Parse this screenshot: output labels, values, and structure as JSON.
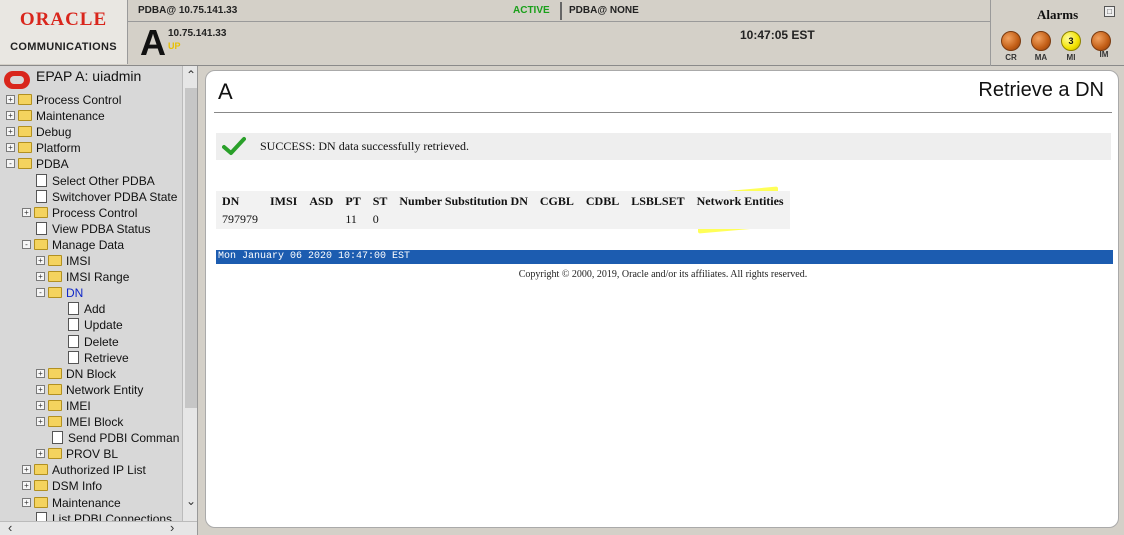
{
  "header": {
    "logo_oracle": "ORACLE",
    "logo_communications": "COMMUNICATIONS",
    "status_left": "PDBA@ 10.75.141.33",
    "status_active": "ACTIVE",
    "status_right": "PDBA@ NONE",
    "node_letter": "A",
    "node_ip": "10.75.141.33",
    "node_state": "UP",
    "time": "10:47:05 EST"
  },
  "alarms": {
    "title": "Alarms",
    "leds": [
      {
        "label": "CR",
        "count": ""
      },
      {
        "label": "MA",
        "count": ""
      },
      {
        "label": "MI",
        "count": "3"
      },
      {
        "label": "IM",
        "count": ""
      }
    ],
    "colors": {
      "off": "#c25e16",
      "minor": "#f2e200"
    }
  },
  "sidebar": {
    "title": "EPAP A: uiadmin",
    "items": [
      {
        "label": "Process Control",
        "icon": "folder-icon",
        "toggle": "+"
      },
      {
        "label": "Maintenance",
        "icon": "folder-icon",
        "toggle": "+"
      },
      {
        "label": "Debug",
        "icon": "folder-icon",
        "toggle": "+"
      },
      {
        "label": "Platform",
        "icon": "folder-icon",
        "toggle": "+"
      },
      {
        "label": "PDBA",
        "icon": "folder-open-icon",
        "toggle": "-"
      },
      {
        "label": "Select Other PDBA",
        "icon": "page-icon"
      },
      {
        "label": "Switchover PDBA State",
        "icon": "page-icon"
      },
      {
        "label": "Process Control",
        "icon": "folder-icon",
        "toggle": "+"
      },
      {
        "label": "View PDBA Status",
        "icon": "page-icon"
      },
      {
        "label": "Manage Data",
        "icon": "folder-open-icon",
        "toggle": "-"
      },
      {
        "label": "IMSI",
        "icon": "folder-icon",
        "toggle": "+"
      },
      {
        "label": "IMSI Range",
        "icon": "folder-icon",
        "toggle": "+"
      },
      {
        "label": "DN",
        "icon": "folder-open-icon",
        "toggle": "-",
        "active": true
      },
      {
        "label": "Add",
        "icon": "page-icon"
      },
      {
        "label": "Update",
        "icon": "page-icon"
      },
      {
        "label": "Delete",
        "icon": "page-icon"
      },
      {
        "label": "Retrieve",
        "icon": "page-icon"
      },
      {
        "label": "DN Block",
        "icon": "folder-icon",
        "toggle": "+"
      },
      {
        "label": "Network Entity",
        "icon": "folder-icon",
        "toggle": "+"
      },
      {
        "label": "IMEI",
        "icon": "folder-icon",
        "toggle": "+"
      },
      {
        "label": "IMEI Block",
        "icon": "folder-icon",
        "toggle": "+"
      },
      {
        "label": "Send PDBI Comman",
        "icon": "page-icon"
      },
      {
        "label": "PROV BL",
        "icon": "folder-icon",
        "toggle": "+"
      },
      {
        "label": "Authorized IP List",
        "icon": "folder-icon",
        "toggle": "+"
      },
      {
        "label": "DSM Info",
        "icon": "folder-icon",
        "toggle": "+"
      },
      {
        "label": "Maintenance",
        "icon": "folder-icon",
        "toggle": "+"
      },
      {
        "label": "List PDBI Connections",
        "icon": "page-icon"
      }
    ]
  },
  "main": {
    "page_code": "A",
    "page_title": "Retrieve a DN",
    "success_message": "SUCCESS: DN data successfully retrieved.",
    "table": {
      "headers": [
        "DN",
        "IMSI",
        "ASD",
        "PT",
        "ST",
        "Number Substitution DN",
        "CGBL",
        "CDBL",
        "LSBLSET",
        "Network Entities"
      ],
      "rows": [
        [
          "797979",
          "",
          "",
          "11",
          "0",
          "",
          "",
          "",
          "",
          ""
        ]
      ]
    },
    "date_bar": "Mon January 06 2020 10:47:00 EST",
    "copyright": "Copyright © 2000, 2019, Oracle and/or its affiliates. All rights reserved."
  },
  "colors": {
    "accent_red": "#d9261c",
    "success_green": "#2aa02a",
    "date_bar_blue": "#1c5cb0",
    "highlight_yellow": "#ffff2e",
    "active_link": "#1028c8"
  }
}
